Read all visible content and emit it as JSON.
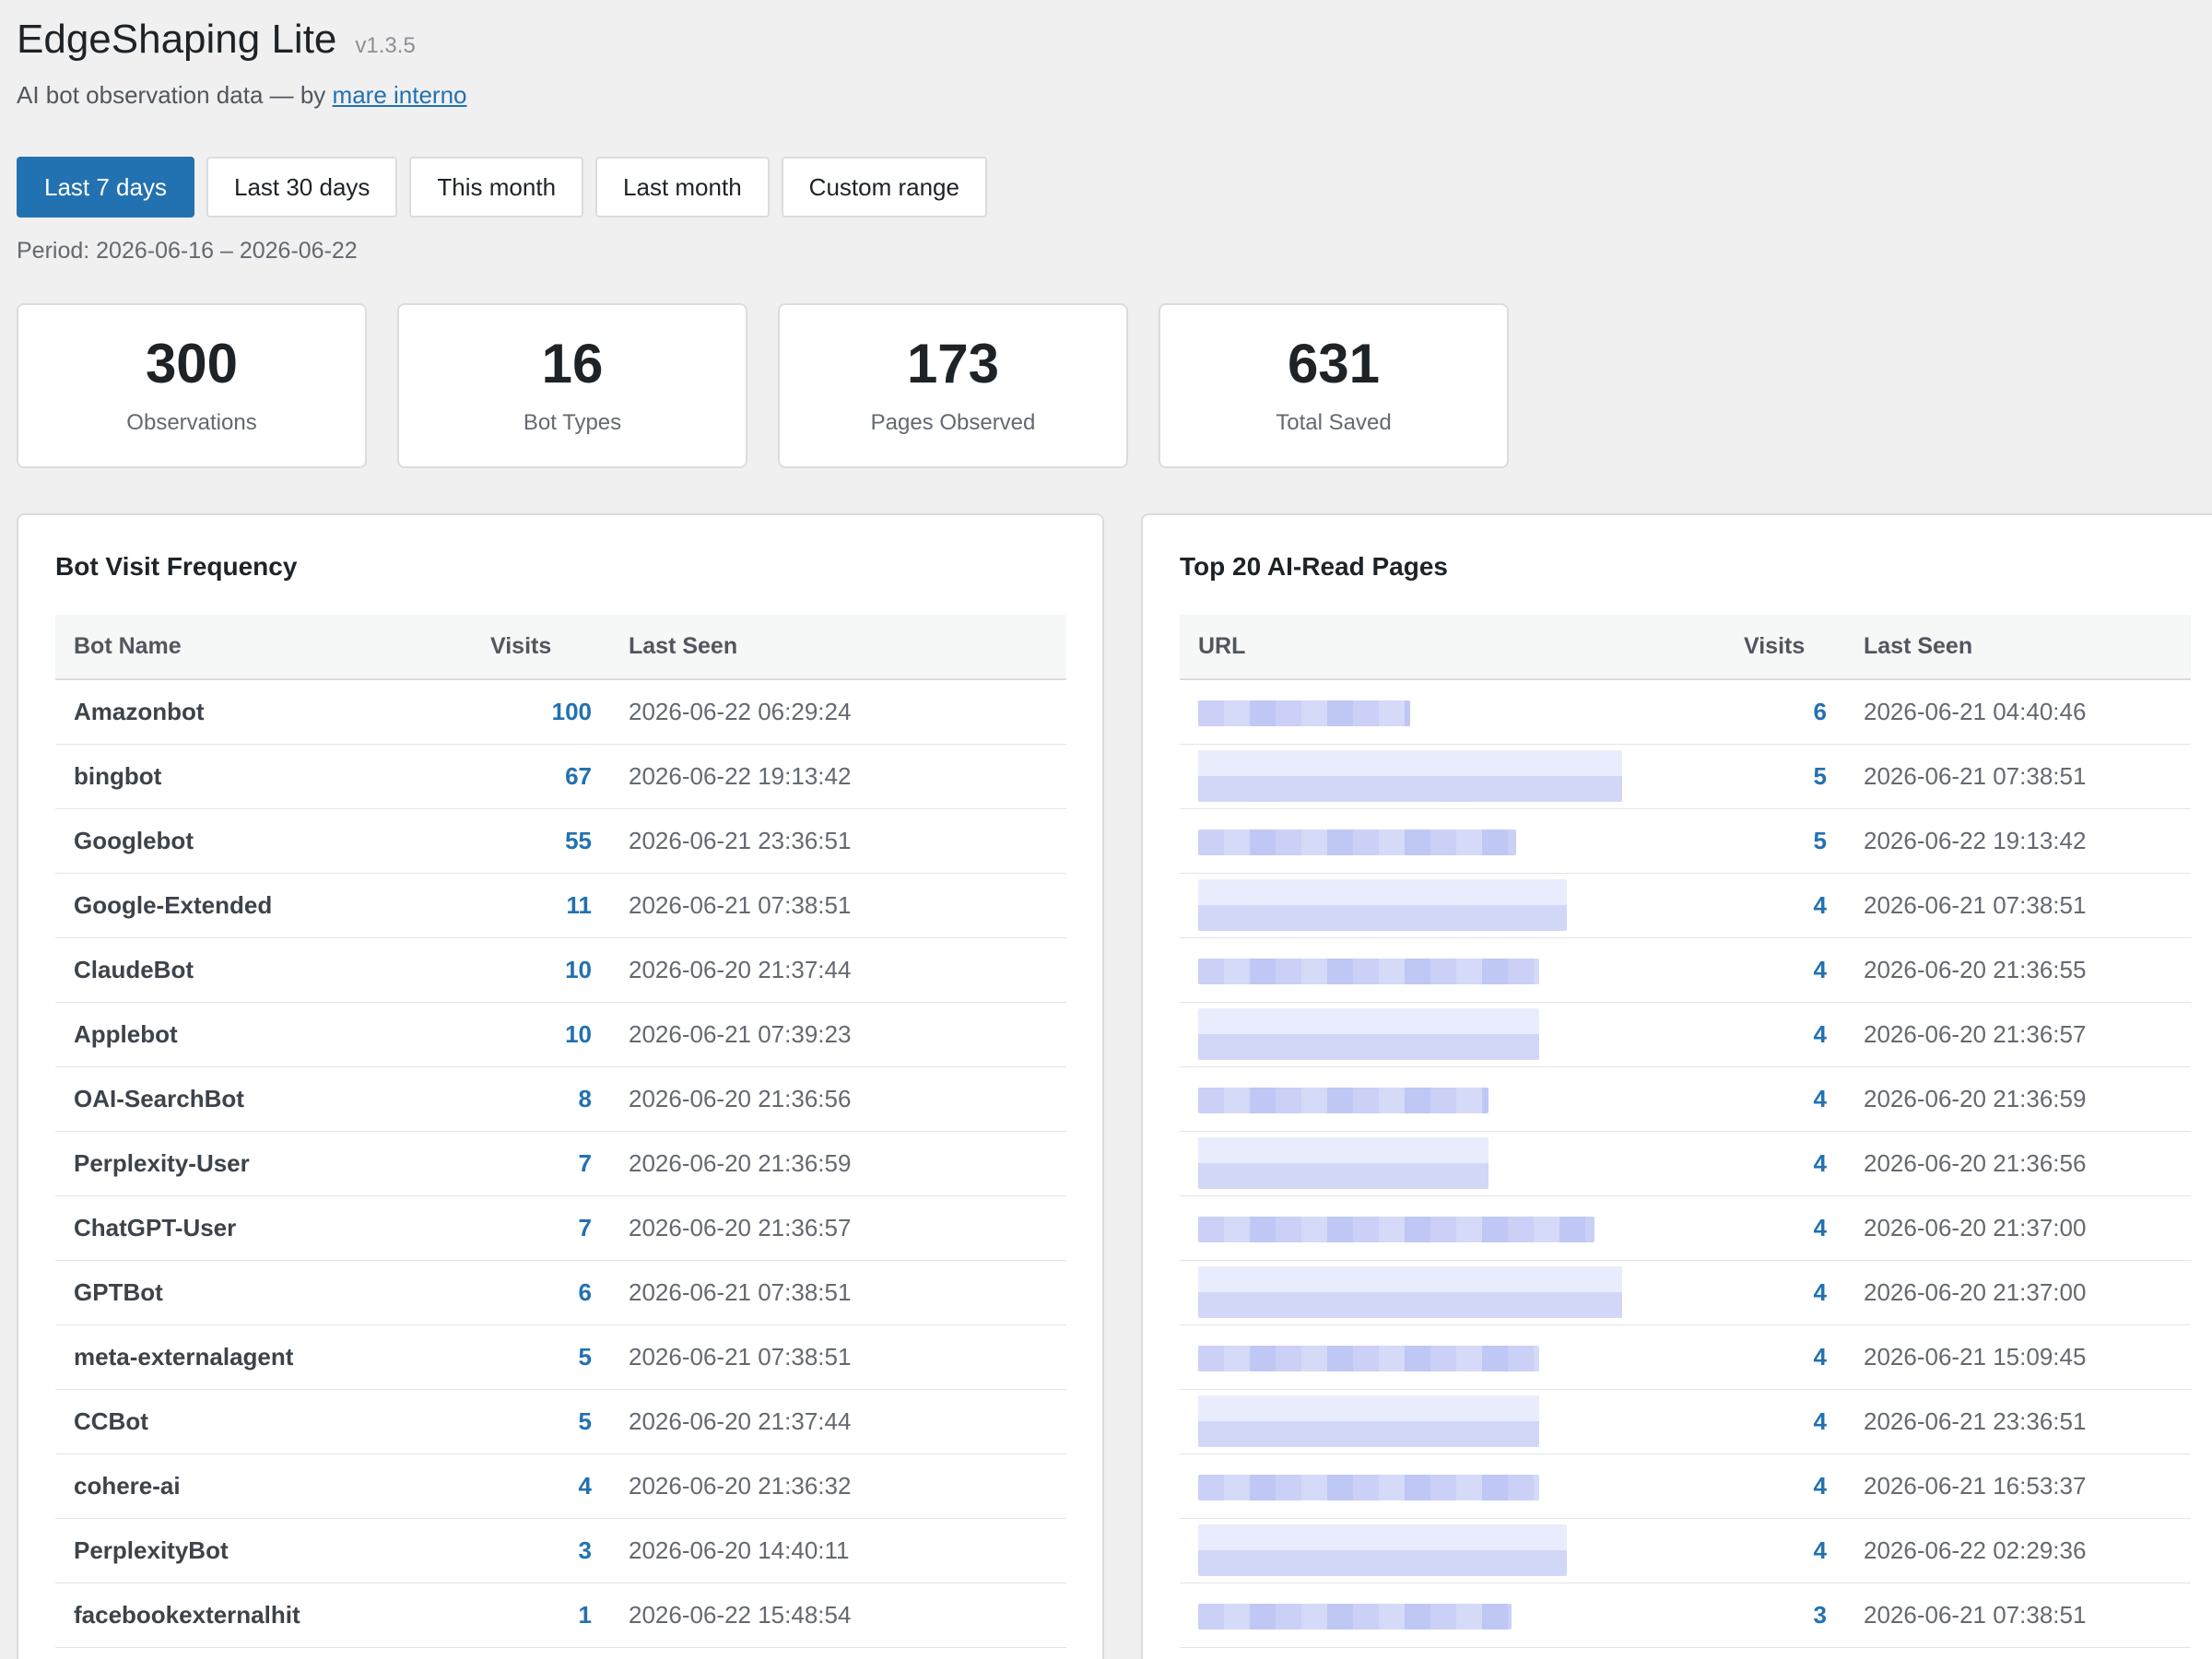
{
  "header": {
    "title": "EdgeShaping Lite",
    "version": "v1.3.5",
    "subtitle_prefix": "AI bot observation data — by",
    "author_link": "mare interno"
  },
  "tabs": [
    {
      "label": "Last 7 days",
      "active": true
    },
    {
      "label": "Last 30 days",
      "active": false
    },
    {
      "label": "This month",
      "active": false
    },
    {
      "label": "Last month",
      "active": false
    },
    {
      "label": "Custom range",
      "active": false
    }
  ],
  "period": "Period: 2026-06-16 – 2026-06-22",
  "stats": [
    {
      "value": "300",
      "label": "Observations"
    },
    {
      "value": "16",
      "label": "Bot Types"
    },
    {
      "value": "173",
      "label": "Pages Observed"
    },
    {
      "value": "631",
      "label": "Total Saved"
    }
  ],
  "bot_panel": {
    "title": "Bot Visit Frequency",
    "columns": [
      "Bot Name",
      "Visits",
      "Last Seen"
    ],
    "rows": [
      {
        "name": "Amazonbot",
        "visits": "100",
        "last_seen": "2026-06-22 06:29:24"
      },
      {
        "name": "bingbot",
        "visits": "67",
        "last_seen": "2026-06-22 19:13:42"
      },
      {
        "name": "Googlebot",
        "visits": "55",
        "last_seen": "2026-06-21 23:36:51"
      },
      {
        "name": "Google-Extended",
        "visits": "11",
        "last_seen": "2026-06-21 07:38:51"
      },
      {
        "name": "ClaudeBot",
        "visits": "10",
        "last_seen": "2026-06-20 21:37:44"
      },
      {
        "name": "Applebot",
        "visits": "10",
        "last_seen": "2026-06-21 07:39:23"
      },
      {
        "name": "OAI-SearchBot",
        "visits": "8",
        "last_seen": "2026-06-20 21:36:56"
      },
      {
        "name": "Perplexity-User",
        "visits": "7",
        "last_seen": "2026-06-20 21:36:59"
      },
      {
        "name": "ChatGPT-User",
        "visits": "7",
        "last_seen": "2026-06-20 21:36:57"
      },
      {
        "name": "GPTBot",
        "visits": "6",
        "last_seen": "2026-06-21 07:38:51"
      },
      {
        "name": "meta-externalagent",
        "visits": "5",
        "last_seen": "2026-06-21 07:38:51"
      },
      {
        "name": "CCBot",
        "visits": "5",
        "last_seen": "2026-06-20 21:37:44"
      },
      {
        "name": "cohere-ai",
        "visits": "4",
        "last_seen": "2026-06-20 21:36:32"
      },
      {
        "name": "PerplexityBot",
        "visits": "3",
        "last_seen": "2026-06-20 14:40:11"
      },
      {
        "name": "facebookexternalhit",
        "visits": "1",
        "last_seen": "2026-06-22 15:48:54"
      }
    ]
  },
  "pages_panel": {
    "title": "Top 20 AI-Read Pages",
    "columns": [
      "URL",
      "Visits",
      "Last Seen"
    ],
    "rows": [
      {
        "visits": "6",
        "last_seen": "2026-06-21 04:40:46"
      },
      {
        "visits": "5",
        "last_seen": "2026-06-21 07:38:51"
      },
      {
        "visits": "5",
        "last_seen": "2026-06-22 19:13:42"
      },
      {
        "visits": "4",
        "last_seen": "2026-06-21 07:38:51"
      },
      {
        "visits": "4",
        "last_seen": "2026-06-20 21:36:55"
      },
      {
        "visits": "4",
        "last_seen": "2026-06-20 21:36:57"
      },
      {
        "visits": "4",
        "last_seen": "2026-06-20 21:36:59"
      },
      {
        "visits": "4",
        "last_seen": "2026-06-20 21:36:56"
      },
      {
        "visits": "4",
        "last_seen": "2026-06-20 21:37:00"
      },
      {
        "visits": "4",
        "last_seen": "2026-06-20 21:37:00"
      },
      {
        "visits": "4",
        "last_seen": "2026-06-21 15:09:45"
      },
      {
        "visits": "4",
        "last_seen": "2026-06-21 23:36:51"
      },
      {
        "visits": "4",
        "last_seen": "2026-06-21 16:53:37"
      },
      {
        "visits": "4",
        "last_seen": "2026-06-22 02:29:36"
      },
      {
        "visits": "3",
        "last_seen": "2026-06-21 07:38:51"
      }
    ]
  }
}
